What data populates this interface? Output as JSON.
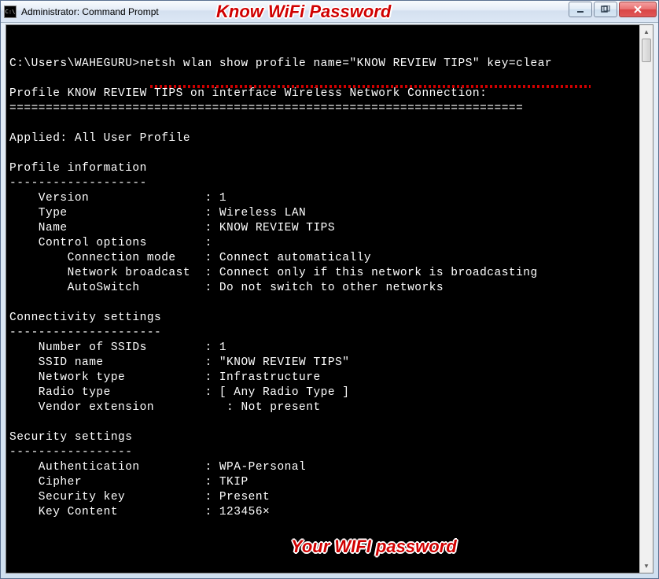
{
  "window": {
    "title": "Administrator: Command Prompt"
  },
  "annotations": {
    "top": "Know WiFi Password",
    "bottom": "Your WIFI password"
  },
  "terminal": {
    "blank1": "",
    "blank2": "",
    "prompt_line": "C:\\Users\\WAHEGURU>netsh wlan show profile name=\"KNOW REVIEW TIPS\" key=clear",
    "blank3": "",
    "header1": "Profile KNOW REVIEW TIPS on interface Wireless Network Connection:",
    "header1_underline": "=======================================================================",
    "blank4": "",
    "applied": "Applied: All User Profile",
    "blank5": "",
    "section1": "Profile information",
    "section1_underline": "-------------------",
    "pi_version": "    Version                : 1",
    "pi_type": "    Type                   : Wireless LAN",
    "pi_name": "    Name                   : KNOW REVIEW TIPS",
    "pi_control": "    Control options        :",
    "pi_connmode": "        Connection mode    : Connect automatically",
    "pi_broadcast": "        Network broadcast  : Connect only if this network is broadcasting",
    "pi_autoswitch": "        AutoSwitch         : Do not switch to other networks",
    "blank6": "",
    "section2": "Connectivity settings",
    "section2_underline": "---------------------",
    "cs_numssids": "    Number of SSIDs        : 1",
    "cs_ssidname": "    SSID name              : \"KNOW REVIEW TIPS\"",
    "cs_nettype": "    Network type           : Infrastructure",
    "cs_radiotype": "    Radio type             : [ Any Radio Type ]",
    "cs_vendor": "    Vendor extension          : Not present",
    "blank7": "",
    "section3": "Security settings",
    "section3_underline": "-----------------",
    "ss_auth": "    Authentication         : WPA-Personal",
    "ss_cipher": "    Cipher                 : TKIP",
    "ss_seckey": "    Security key           : Present",
    "ss_keycont": "    Key Content            : 123456×"
  }
}
